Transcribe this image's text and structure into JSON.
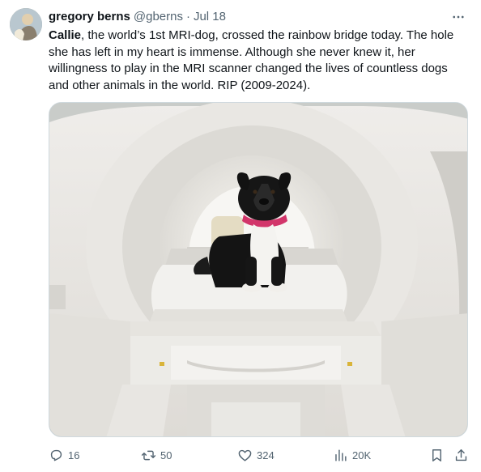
{
  "author": {
    "name": "gregory berns",
    "handle": "@gberns",
    "separator": "·",
    "date": "Jul 18"
  },
  "tweet": {
    "bold_lead": "Callie",
    "text_rest": ", the world’s 1st MRI-dog, crossed the rainbow bridge today. The hole she has left in my heart is immense. Although she never knew it, her willingness to play in the MRI scanner changed the lives of countless dogs and other animals in the world. RIP (2009-2024)."
  },
  "actions": {
    "reply_count": "16",
    "retweet_count": "50",
    "like_count": "324",
    "views_count": "20K"
  },
  "icons": {
    "more": "more-horizontal-icon",
    "reply": "reply-icon",
    "retweet": "retweet-icon",
    "like": "heart-icon",
    "views": "views-chart-icon",
    "bookmark": "bookmark-icon",
    "share": "share-icon"
  },
  "colors": {
    "text_primary": "#0f1419",
    "text_secondary": "#536471",
    "border": "#cfd9de"
  }
}
